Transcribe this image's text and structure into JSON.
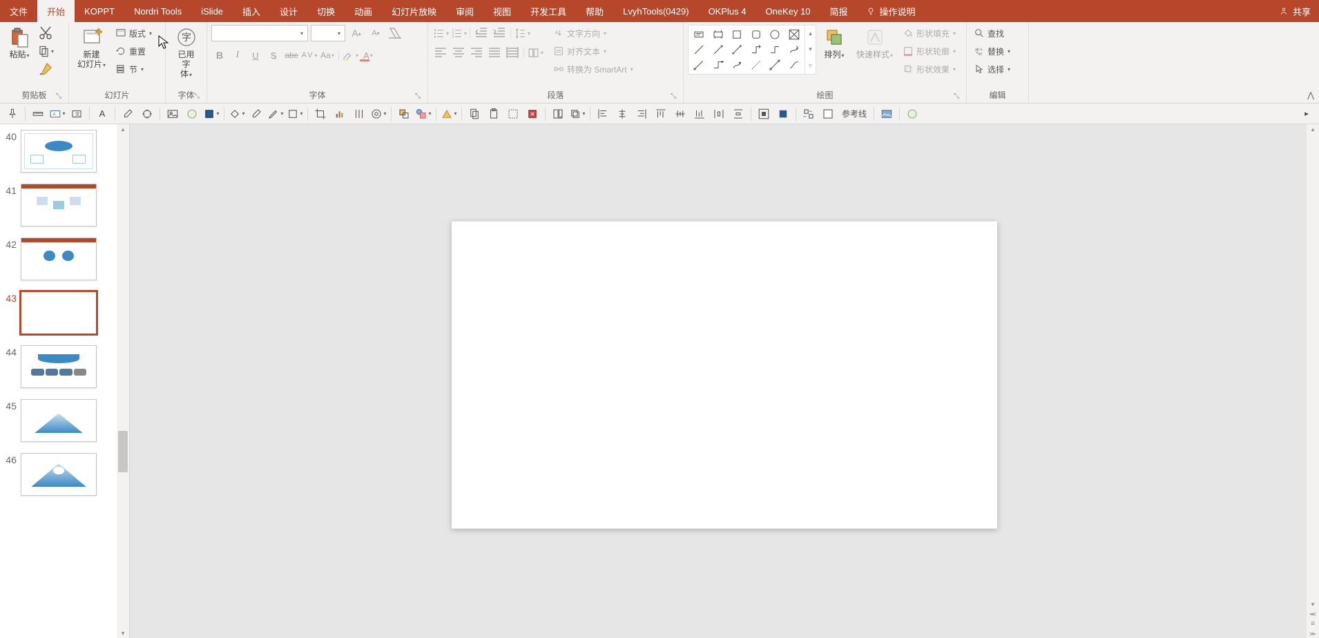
{
  "tabs": {
    "file": "文件",
    "home": "开始",
    "koppt": "KOPPT",
    "nordri": "Nordri Tools",
    "islide": "iSlide",
    "insert": "插入",
    "design": "设计",
    "transition": "切换",
    "animation": "动画",
    "slideshow": "幻灯片放映",
    "review": "审阅",
    "view": "视图",
    "developer": "开发工具",
    "help": "帮助",
    "lvyh": "LvyhTools(0429)",
    "okplus": "OKPlus 4",
    "onekey": "OneKey 10",
    "brief": "简报",
    "tellme": "操作说明",
    "share": "共享"
  },
  "groups": {
    "clipboard": "剪贴板",
    "slides": "幻灯片",
    "usedfont": "字体",
    "font": "字体",
    "paragraph": "段落",
    "drawing": "绘图",
    "editing": "编辑"
  },
  "clipboard": {
    "paste": "粘贴"
  },
  "slides": {
    "new": "新建\n幻灯片",
    "layout": "版式",
    "reset": "重置",
    "section": "节"
  },
  "usedfont": {
    "label": "已用字\n体"
  },
  "font": {
    "name": "",
    "size": ""
  },
  "paragraph": {
    "textdir": "文字方向",
    "align": "对齐文本",
    "smartart": "转换为 SmartArt"
  },
  "drawing": {
    "arrange": "排列",
    "quickstyle": "快速样式",
    "fill": "形状填充",
    "outline": "形状轮廓",
    "effects": "形状效果"
  },
  "editing": {
    "find": "查找",
    "replace": "替换",
    "select": "选择"
  },
  "qat": {
    "guides": "参考线"
  },
  "slidesList": [
    {
      "num": "40",
      "selected": false
    },
    {
      "num": "41",
      "selected": false
    },
    {
      "num": "42",
      "selected": false
    },
    {
      "num": "43",
      "selected": true
    },
    {
      "num": "44",
      "selected": false
    },
    {
      "num": "45",
      "selected": false
    },
    {
      "num": "46",
      "selected": false
    }
  ]
}
